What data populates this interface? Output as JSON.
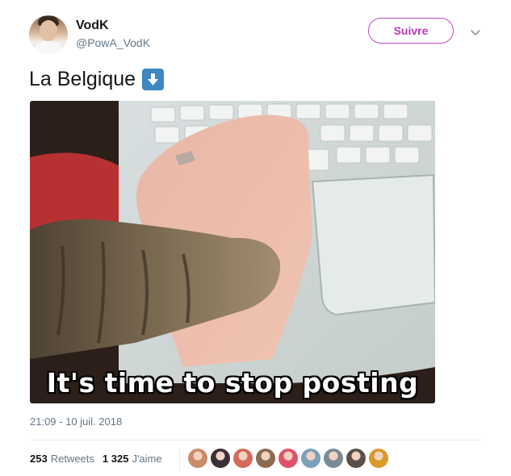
{
  "author": {
    "name": "VodK",
    "handle": "@PowA_VodK"
  },
  "follow_label": "Suivre",
  "tweet": {
    "text": "La Belgique",
    "emoji_icon": "down-arrow-emoji"
  },
  "media": {
    "caption": "It's time to stop posting"
  },
  "timestamp": "21:09 - 10 juil. 2018",
  "stats": {
    "retweets_count": "253",
    "retweets_label": "Retweets",
    "likes_count": "1 325",
    "likes_label": "J'aime"
  },
  "liker_avatars": [
    "#c98b6a",
    "#3b2f38",
    "#d46a5c",
    "#8c6b4f",
    "#e0516e",
    "#7da0b8",
    "#7b8a93",
    "#5a5048",
    "#d99a2a"
  ],
  "colors": {
    "follow_accent": "#c147c3",
    "emoji_blue": "#3b88c3",
    "muted_text": "#657786"
  }
}
